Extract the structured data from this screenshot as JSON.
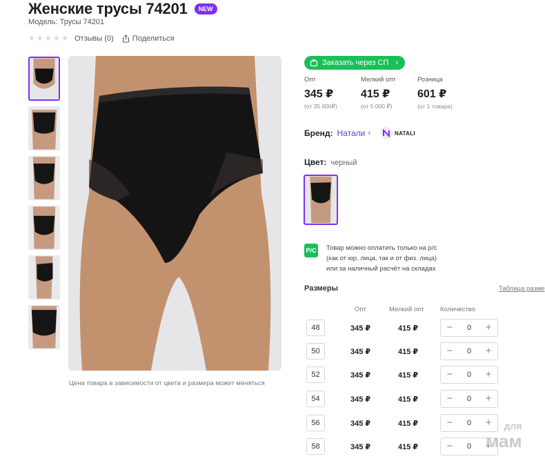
{
  "product": {
    "title": "Женские трусы 74201",
    "badge": "NEW",
    "model": "Модель: Трусы 74201",
    "reviews": "Отзывы (0)",
    "share": "Поделиться",
    "rating_stars": 0,
    "photo_note": "Цена товара в зависимости от цвета и размера может меняться"
  },
  "order_button": {
    "label": "Заказать через СП"
  },
  "prices": [
    {
      "label": "Опт",
      "value": "345 ₽",
      "sub": "(от 35 000₽)"
    },
    {
      "label": "Мелкий опт",
      "value": "415 ₽",
      "sub": "(от 5 000 ₽)"
    },
    {
      "label": "Розница",
      "value": "601 ₽",
      "sub": "(от 1 товара)"
    }
  ],
  "brand": {
    "label": "Бренд:",
    "name": "Натали",
    "logo_text": "NATALI"
  },
  "color": {
    "label": "Цвет:",
    "value": "черный"
  },
  "payment": {
    "icon_text": "P/C",
    "line1": "Товар можно оплатить только на р/с",
    "line2": "(как от юр. лица, так и от физ. лица)",
    "line3": "или за наличный расчёт на складах"
  },
  "sizes": {
    "title": "Размеры",
    "table_link": "Таблица разме",
    "headers": {
      "opt": "Опт",
      "small": "Мелкий опт",
      "qty": "Количество"
    },
    "rows": [
      {
        "size": "48",
        "opt": "345 ₽",
        "small": "415 ₽",
        "qty": "0"
      },
      {
        "size": "50",
        "opt": "345 ₽",
        "small": "415 ₽",
        "qty": "0"
      },
      {
        "size": "52",
        "opt": "345 ₽",
        "small": "415 ₽",
        "qty": "0"
      },
      {
        "size": "54",
        "opt": "345 ₽",
        "small": "415 ₽",
        "qty": "0"
      },
      {
        "size": "56",
        "opt": "345 ₽",
        "small": "415 ₽",
        "qty": "0"
      },
      {
        "size": "58",
        "opt": "345 ₽",
        "small": "415 ₽",
        "qty": "0"
      }
    ]
  },
  "watermark": {
    "line1": "для",
    "line2": "мам"
  },
  "colors": {
    "accent": "#7b2ff7",
    "green": "#1bbf5a",
    "link": "#5a3ad6"
  }
}
